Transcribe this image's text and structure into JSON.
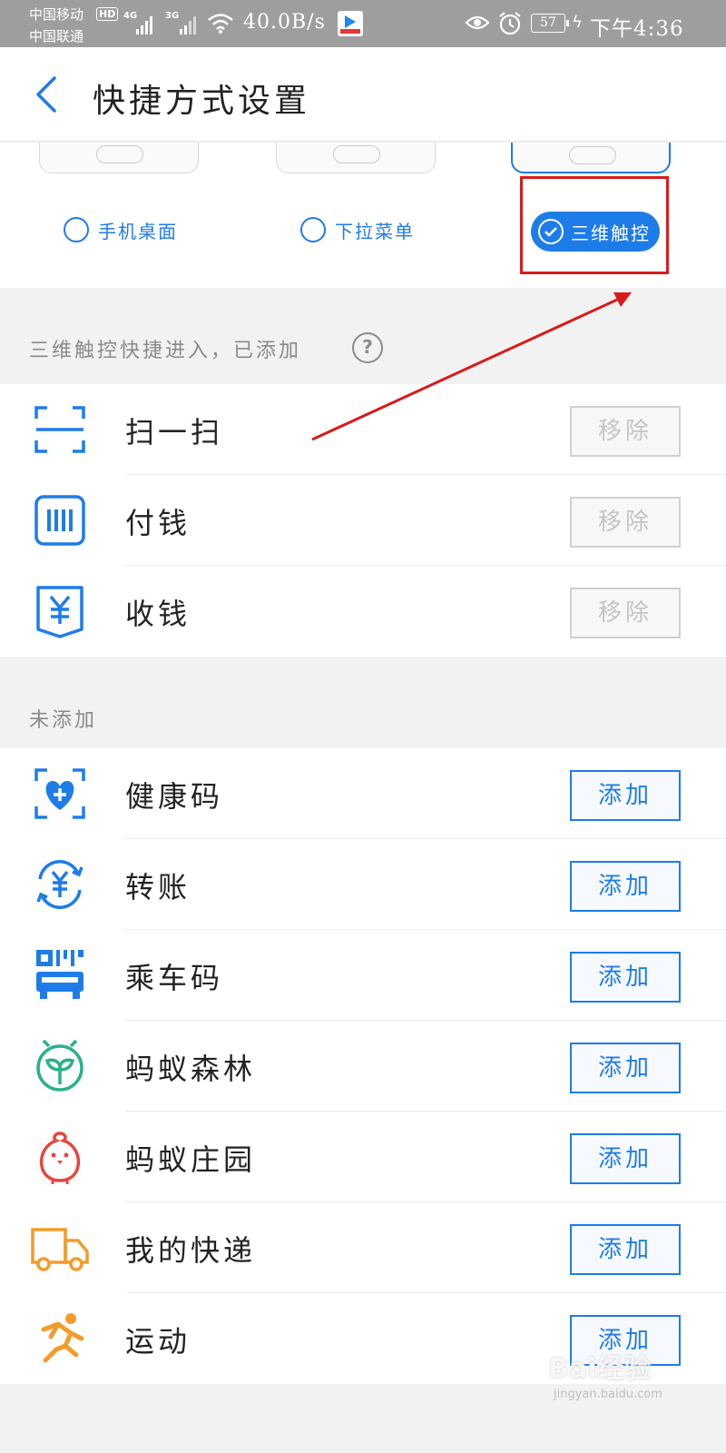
{
  "status_bar": {
    "carrier1": "中国移动",
    "carrier2": "中国联通",
    "hd": "HD",
    "net1": "4G",
    "net2": "3G",
    "speed": "40.0B/s",
    "battery": "57",
    "time": "下午4:36"
  },
  "header": {
    "title": "快捷方式设置"
  },
  "entry_options": [
    {
      "label": "手机桌面",
      "selected": false
    },
    {
      "label": "下拉菜单",
      "selected": false
    },
    {
      "label": "三维触控",
      "selected": true
    }
  ],
  "added_section": {
    "title": "三维触控快捷进入，已添加",
    "help": "?",
    "items": [
      {
        "label": "扫一扫",
        "icon": "scan-icon",
        "action": "移除"
      },
      {
        "label": "付钱",
        "icon": "pay-barcode-icon",
        "action": "移除"
      },
      {
        "label": "收钱",
        "icon": "receive-money-icon",
        "action": "移除"
      }
    ]
  },
  "not_added_section": {
    "title": "未添加",
    "items": [
      {
        "label": "健康码",
        "icon": "health-code-icon",
        "action": "添加"
      },
      {
        "label": "转账",
        "icon": "transfer-icon",
        "action": "添加"
      },
      {
        "label": "乘车码",
        "icon": "bus-code-icon",
        "action": "添加"
      },
      {
        "label": "蚂蚁森林",
        "icon": "ant-forest-icon",
        "action": "添加"
      },
      {
        "label": "蚂蚁庄园",
        "icon": "ant-farm-icon",
        "action": "添加"
      },
      {
        "label": "我的快递",
        "icon": "delivery-truck-icon",
        "action": "添加"
      },
      {
        "label": "运动",
        "icon": "running-icon",
        "action": "添加"
      }
    ]
  },
  "watermark": {
    "text": "Bai经验",
    "sub": "jingyan.baidu.com"
  },
  "colors": {
    "accent": "#1e7ce8",
    "highlight": "#d81b1b",
    "forest": "#2bb08b",
    "farm": "#e8453c",
    "delivery": "#f39c2a"
  }
}
